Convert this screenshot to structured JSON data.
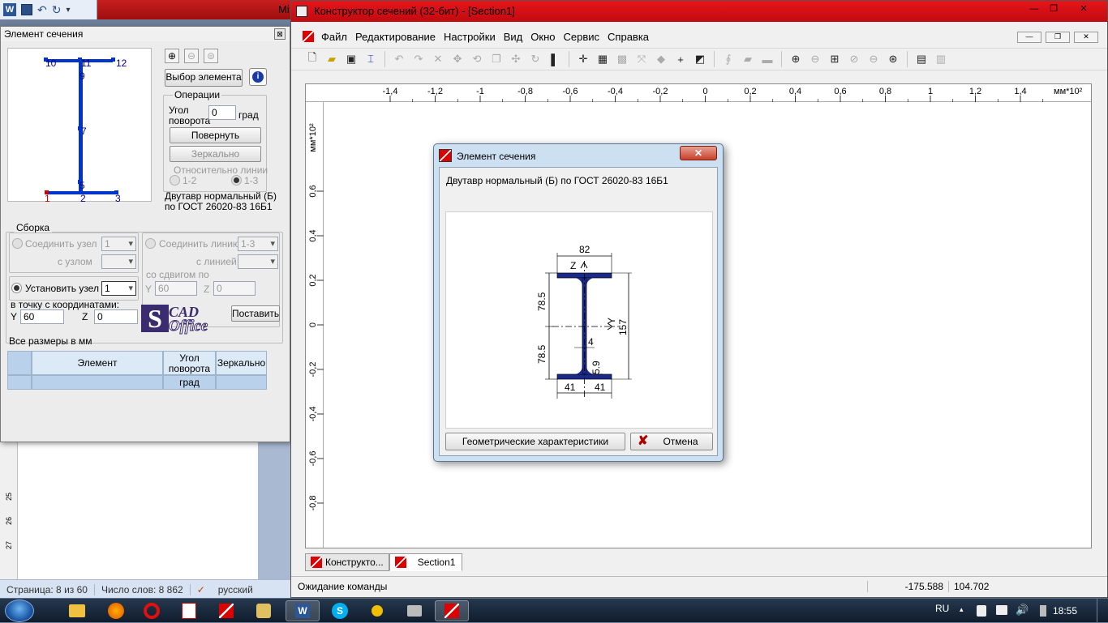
{
  "word": {
    "title_fragment": "Mi",
    "status": {
      "page": "Страница: 8 из 60",
      "words": "Число слов: 8 862",
      "lang": "русский"
    },
    "ruler_marks": [
      "25",
      "26",
      "27"
    ]
  },
  "left_dialog": {
    "title": "Элемент сечения",
    "select_element_btn": "Выбор элемента",
    "operations": {
      "title": "Операции",
      "angle_label": "Угол\nповорота",
      "angle_value": "0",
      "angle_unit": "град",
      "rotate_btn": "Повернуть",
      "mirror_btn": "Зеркально",
      "relative_label": "Относительно линии",
      "opt1": "1-2",
      "opt2": "1-3"
    },
    "element_name": "Двутавр нормальный (Б) по ГОСТ 26020-83  16Б1",
    "preview_nodes": [
      "10",
      "11",
      "12",
      "9",
      "7",
      "5",
      "1",
      "2",
      "3"
    ],
    "assembly": {
      "title": "Сборка",
      "connect_node": "Соединить узел",
      "connect_node_val": "1",
      "with_node": "с узлом",
      "connect_line": "Соединить линию",
      "connect_line_val": "1-3",
      "with_line": "с линией",
      "shift_label": "со сдвигом по",
      "shift_y_label": "Y",
      "shift_y": "60",
      "shift_z_label": "Z",
      "shift_z": "0",
      "set_node": "Установить узел",
      "set_node_val": "1",
      "at_point": "в точку с координатами:",
      "y_label": "Y",
      "y_val": "60",
      "z_label": "Z",
      "z_val": "0",
      "place_btn": "Поставить"
    },
    "logo_top": "CAD",
    "logo_bottom": "Office",
    "units_note": "Все размеры в мм",
    "table": {
      "headers": [
        "Элемент",
        "Угол\nповорота",
        "Зеркально"
      ],
      "unit_row": [
        "",
        "град",
        ""
      ]
    }
  },
  "main_window": {
    "title": "Конструктор сечений (32-бит) - [Section1]",
    "menu": [
      "Файл",
      "Редактирование",
      "Настройки",
      "Вид",
      "Окно",
      "Сервис",
      "Справка"
    ],
    "h_ruler": [
      "-1,4",
      "-1,2",
      "-1",
      "-0,8",
      "-0,6",
      "-0,4",
      "-0,2",
      "0",
      "0,2",
      "0,4",
      "0,6",
      "0,8",
      "1",
      "1,2",
      "1,4"
    ],
    "h_ruler_unit": "мм*10²",
    "v_ruler": [
      "0,6",
      "0,4",
      "0,2",
      "0",
      "-0,2",
      "-0,4",
      "-0,6",
      "-0,8"
    ],
    "v_ruler_unit": "мм*10²",
    "tabs": [
      "Конструкто...",
      "Section1"
    ],
    "status": "Ожидание команды",
    "coord_x": "-175.588",
    "coord_y": "104.702"
  },
  "modal": {
    "title": "Элемент сечения",
    "element_name": "Двутавр нормальный (Б) по ГОСТ 26020-83  16Б1",
    "dims": {
      "width": "82",
      "half_left": "41",
      "half_right": "41",
      "height": "157",
      "upper": "78.5",
      "lower": "78.5",
      "web": "4",
      "flange": "5.9",
      "axis_z": "Z",
      "axis_y": "Y"
    },
    "geom_btn": "Геометрические характеристики",
    "cancel_btn": "Отмена"
  },
  "taskbar": {
    "lang": "RU",
    "time": "18:55"
  }
}
